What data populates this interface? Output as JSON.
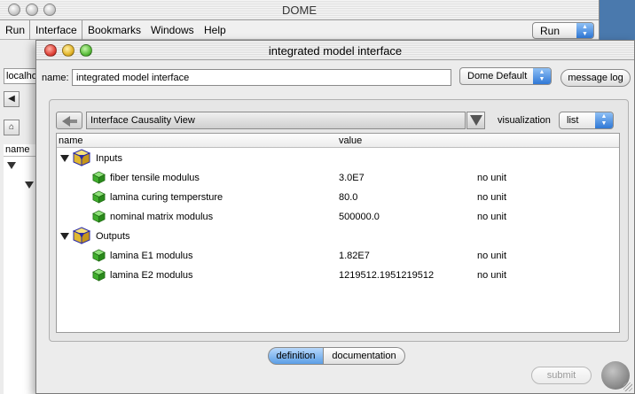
{
  "back_window": {
    "title": "DOME",
    "menu": [
      "Run",
      "Interface",
      "Bookmarks",
      "Windows",
      "Help"
    ],
    "run_select": "Run",
    "server_field": "localhost",
    "tree_header": "name"
  },
  "window": {
    "title": "integrated model interface"
  },
  "header": {
    "name_label": "name:",
    "name_value": "integrated model interface",
    "dome_select": "Dome Default",
    "message_log": "message log"
  },
  "view": {
    "select": "Interface Causality View",
    "visualization_label": "visualization",
    "visualization_value": "list"
  },
  "table": {
    "columns": [
      "name",
      "value"
    ],
    "groups": [
      {
        "label": "Inputs",
        "rows": [
          {
            "name": "fiber tensile modulus",
            "value": "3.0E7",
            "unit": "no unit"
          },
          {
            "name": "lamina curing tempersture",
            "value": "80.0",
            "unit": "no unit"
          },
          {
            "name": "nominal matrix modulus",
            "value": "500000.0",
            "unit": "no unit"
          }
        ]
      },
      {
        "label": "Outputs",
        "rows": [
          {
            "name": "lamina E1 modulus",
            "value": "1.82E7",
            "unit": "no unit"
          },
          {
            "name": "lamina E2 modulus",
            "value": "1219512.1951219512",
            "unit": "no unit"
          }
        ]
      }
    ]
  },
  "tabs": [
    "definition",
    "documentation"
  ],
  "submit_label": "submit"
}
